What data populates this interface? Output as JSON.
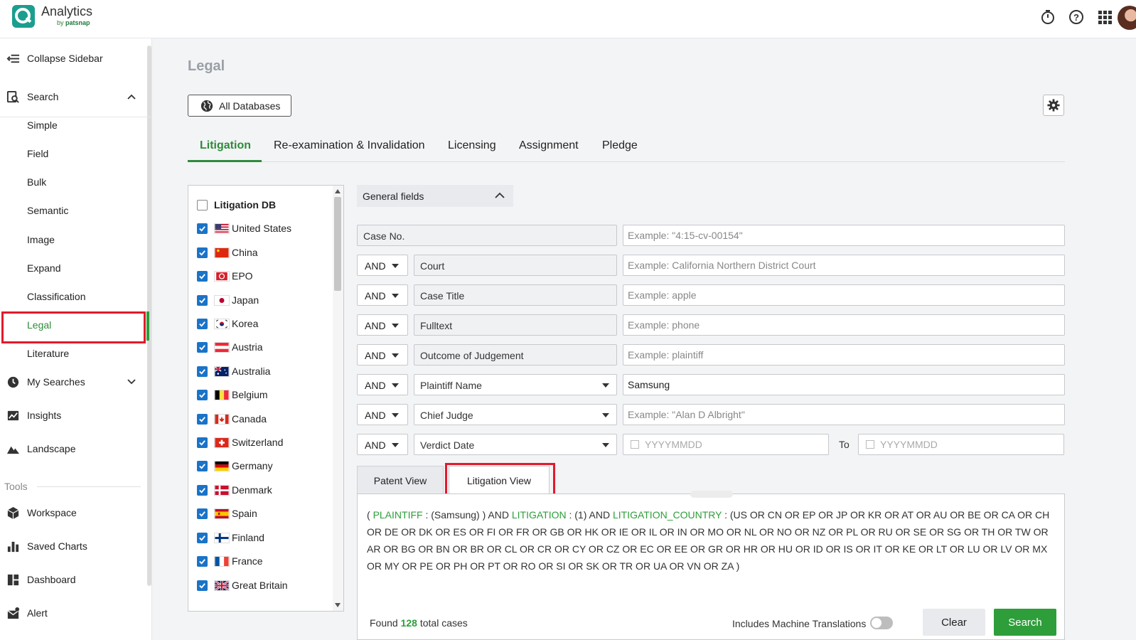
{
  "app": {
    "title": "Analytics",
    "subtitle_by": "by",
    "subtitle_brand": "patsnap"
  },
  "colors": {
    "accent": "#2e9e3a",
    "highlight": "#e21a2c",
    "checkbox": "#1a73c7"
  },
  "header_icons": [
    "timer-icon",
    "help-icon",
    "apps-grid-icon",
    "user-avatar"
  ],
  "sidebar": {
    "collapse_label": "Collapse Sidebar",
    "search_label": "Search",
    "search_items": [
      "Simple",
      "Field",
      "Bulk",
      "Semantic",
      "Image",
      "Expand",
      "Classification",
      "Legal",
      "Literature"
    ],
    "my_searches_label": "My Searches",
    "insights_label": "Insights",
    "landscape_label": "Landscape",
    "tools_label": "Tools",
    "workspace_label": "Workspace",
    "saved_charts_label": "Saved Charts",
    "dashboard_label": "Dashboard",
    "alert_label": "Alert"
  },
  "main": {
    "page_title": "Legal",
    "all_databases_label": "All Databases",
    "tabs": [
      "Litigation",
      "Re-examination & Invalidation",
      "Licensing",
      "Assignment",
      "Pledge"
    ]
  },
  "db_list": {
    "header": "Litigation DB",
    "items": [
      "United States",
      "China",
      "EPO",
      "Japan",
      "Korea",
      "Austria",
      "Australia",
      "Belgium",
      "Canada",
      "Switzerland",
      "Germany",
      "Denmark",
      "Spain",
      "Finland",
      "France",
      "Great Britain"
    ]
  },
  "fields": {
    "section_label": "General fields",
    "rows": [
      {
        "operator": "",
        "label": "Case No.",
        "placeholder": "Example: \"4:15-cv-00154\"",
        "value": ""
      },
      {
        "operator": "AND",
        "label": "Court",
        "placeholder": "Example: California Northern District Court",
        "value": ""
      },
      {
        "operator": "AND",
        "label": "Case Title",
        "placeholder": "Example: apple",
        "value": ""
      },
      {
        "operator": "AND",
        "label": "Fulltext",
        "placeholder": "Example: phone",
        "value": ""
      },
      {
        "operator": "AND",
        "label": "Outcome of Judgement",
        "placeholder": "Example: plaintiff",
        "value": ""
      },
      {
        "operator": "AND",
        "label": "Plaintiff Name",
        "placeholder": "",
        "value": "Samsung"
      },
      {
        "operator": "AND",
        "label": "Chief Judge",
        "placeholder": "Example: \"Alan D Albright\"",
        "value": ""
      },
      {
        "operator": "AND",
        "label": "Verdict Date",
        "placeholder": "",
        "value": ""
      }
    ],
    "date_placeholder": "YYYYMMDD",
    "to_label": "To"
  },
  "query": {
    "patent_view_label": "Patent View",
    "litigation_view_label": "Litigation View",
    "p1": "( ",
    "k1": "PLAINTIFF",
    "p2": " : (Samsung) ) AND ",
    "k2": "LITIGATION",
    "p3": " : (1) AND ",
    "k3": "LITIGATION_COUNTRY",
    "p4": " : (US OR CN OR EP OR JP OR KR OR AT OR AU OR BE OR CA OR CH OR DE OR DK OR ES OR FI OR FR OR GB OR HK OR IE OR IL OR IN OR MO OR NL OR NO OR NZ OR PL OR RU OR SE OR SG OR TH OR TW OR AR OR BG OR BN OR BR OR CL OR CR OR CY OR CZ OR EC OR EE OR GR OR HR OR HU OR ID OR IS OR IT OR KE OR LT OR LU OR LV OR MX OR MY OR PE OR PH OR PT OR RO OR SI OR SK OR TR OR UA OR VN OR ZA )"
  },
  "footer": {
    "found_prefix": "Found",
    "found_count": "128",
    "found_suffix": "total cases",
    "machine_translation_label": "Includes Machine Translations",
    "clear_label": "Clear",
    "search_label": "Search"
  }
}
